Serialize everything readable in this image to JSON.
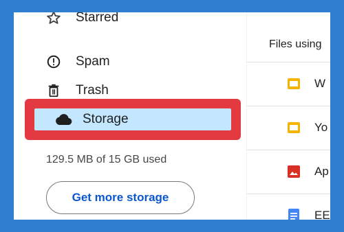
{
  "sidebar": {
    "items": [
      {
        "label": "Starred",
        "icon": "star-icon"
      },
      {
        "label": "Spam",
        "icon": "spam-icon"
      },
      {
        "label": "Trash",
        "icon": "trash-icon"
      }
    ],
    "storage": {
      "label": "Storage",
      "icon": "cloud-icon"
    },
    "usage_text": "129.5 MB of 15 GB used",
    "get_more_label": "Get more storage"
  },
  "main": {
    "header": "Files using",
    "files": [
      {
        "name": "W",
        "icon": "slides-icon",
        "color": "#f4b400"
      },
      {
        "name": "Yo",
        "icon": "slides-icon",
        "color": "#f4b400"
      },
      {
        "name": "Ap",
        "icon": "image-icon",
        "color": "#d93025"
      },
      {
        "name": "EE",
        "icon": "docs-icon",
        "color": "#4285f4"
      }
    ]
  },
  "colors": {
    "background": "#2f7fd1",
    "highlight_border": "#e23a40",
    "storage_selected": "#c2e7ff",
    "button_text": "#0b57d0"
  }
}
